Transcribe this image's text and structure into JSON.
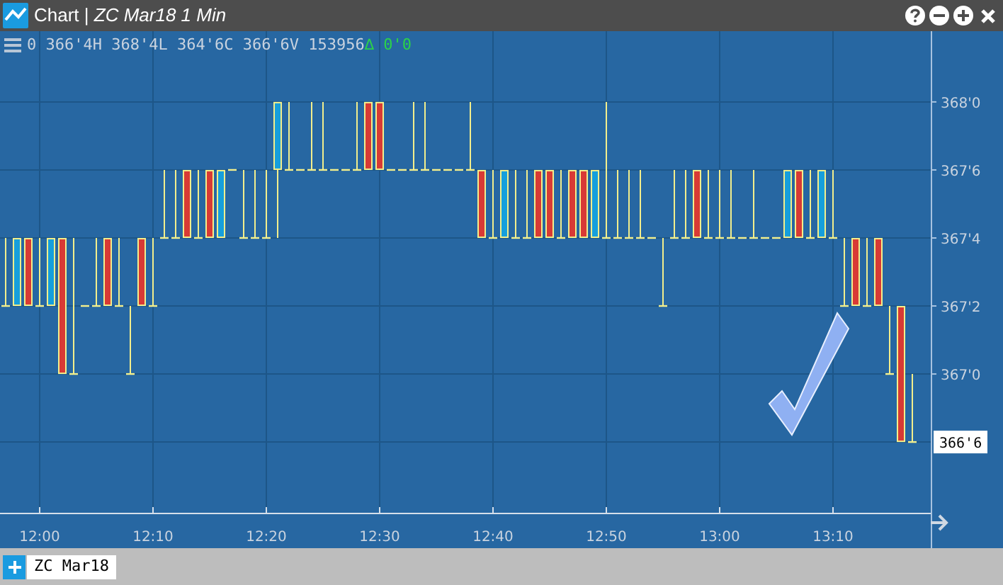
{
  "window": {
    "title": "Chart | *ZC Mar18 1 Min*"
  },
  "header": {
    "ohlc_text": "0 366'4H 368'4L 364'6C 366'6V 153956",
    "change_text": "∆ 0'0"
  },
  "chart": {
    "last_price_label": "366'6",
    "y_axis_labels": [
      "368'0",
      "367'6",
      "367'4",
      "367'2",
      "367'0"
    ],
    "x_axis_labels": [
      "12:00",
      "12:10",
      "12:20",
      "12:30",
      "12:40",
      "12:50",
      "13:00",
      "13:10"
    ]
  },
  "tabs": [
    {
      "label": "ZC Mar18",
      "selected": true
    }
  ]
}
